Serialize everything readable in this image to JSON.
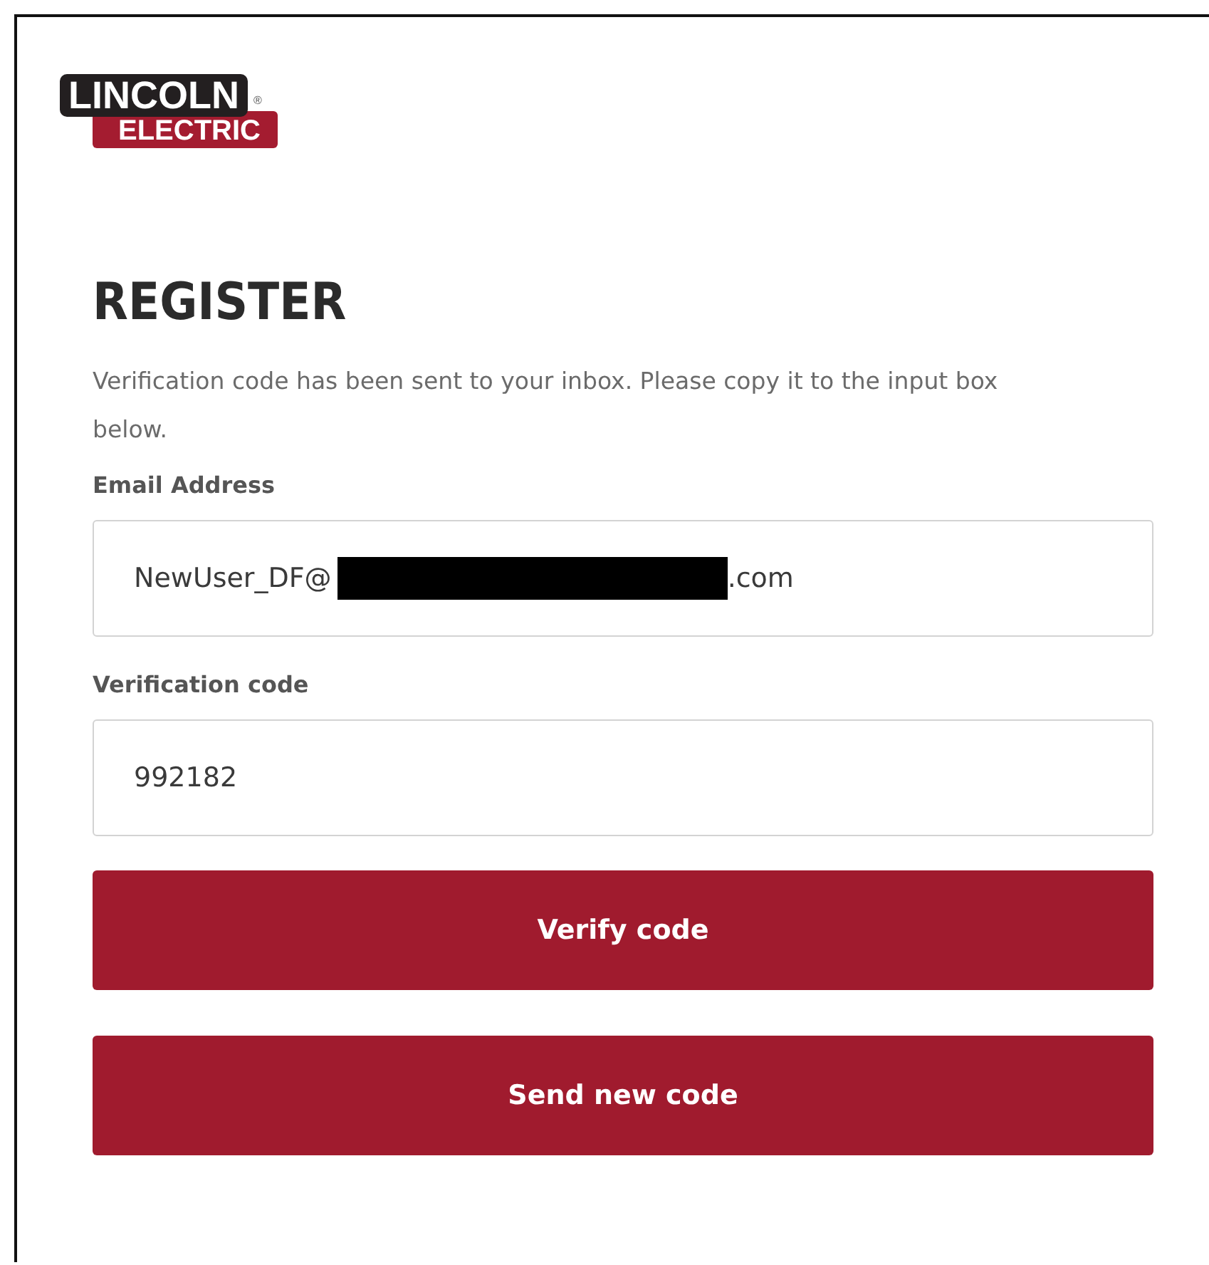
{
  "logo": {
    "top": "LINCOLN",
    "mark": "®",
    "bottom": "ELECTRIC"
  },
  "title": "REGISTER",
  "intro": "Verification code has been sent to your inbox. Please copy it to the input box below.",
  "fields": [
    {
      "label": "Email Address",
      "value_start": "NewUser_DF@",
      "redacted": true,
      "value_end": ".com"
    },
    {
      "label": "Verification code",
      "value_start": "992182",
      "redacted": false
    }
  ],
  "buttons": [
    "Verify code",
    "Send new code"
  ]
}
